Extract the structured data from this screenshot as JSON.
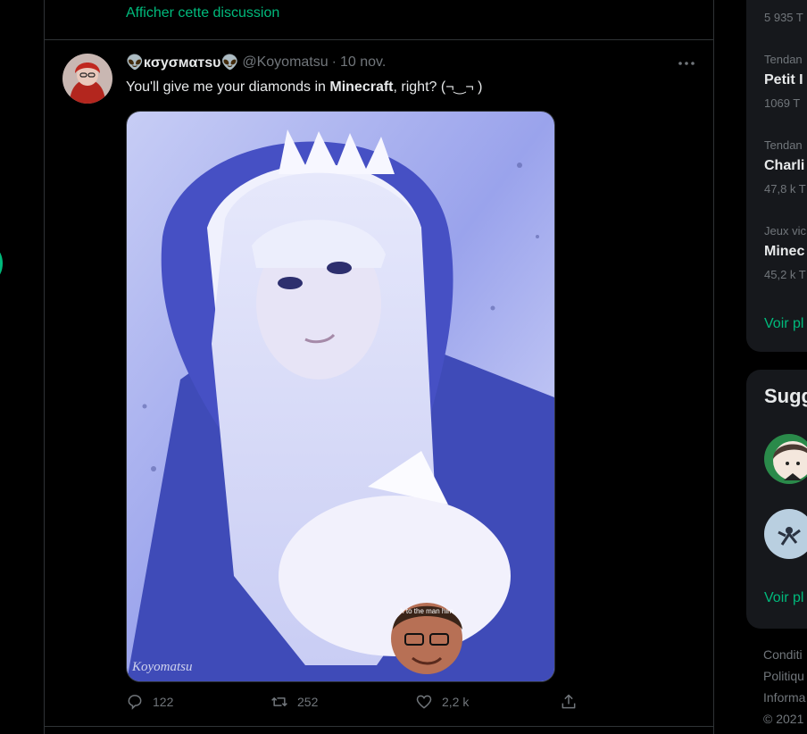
{
  "colors": {
    "accent": "#00ba7c",
    "background": "#000000",
    "border": "#2f3336",
    "muted": "#71767b",
    "text": "#e7e9ea",
    "card": "#16181c"
  },
  "feed": {
    "discussion_link": "Afficher cette discussion",
    "tweet": {
      "display_name": "👽кσуσмαтѕυ👽",
      "handle": "@Koyomatsu",
      "separator": "·",
      "date": "10 nov.",
      "text_before": "You'll give me your diamonds in ",
      "text_bold": "Minecraft",
      "text_after": ", right? (¬‿¬ )",
      "image_watermark": "Koyomatsu",
      "image_sticker_caption": "h to the man him",
      "actions": {
        "reply_icon": "reply-icon",
        "reply_count": "122",
        "retweet_icon": "retweet-icon",
        "retweet_count": "252",
        "like_icon": "heart-icon",
        "like_count": "2,2 k",
        "share_icon": "share-icon"
      }
    }
  },
  "sidebar": {
    "trends": [
      {
        "meta": "",
        "name": "",
        "count": "5 935 T"
      },
      {
        "meta": "Tendan",
        "name": "Petit I",
        "count": "1069 T"
      },
      {
        "meta": "Tendan",
        "name": "Charli",
        "count": "47,8 k T"
      },
      {
        "meta": "Jeux vic",
        "name": "Minec",
        "count": "45,2 k T"
      }
    ],
    "trends_more": "Voir pl",
    "suggestions_title": "Sugg",
    "suggestions_more": "Voir pl",
    "footer": [
      "Conditi",
      "Politiqu",
      "Informa",
      "© 2021"
    ]
  }
}
